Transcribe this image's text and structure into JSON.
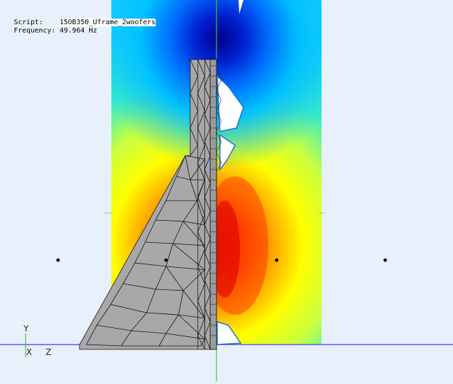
{
  "info": {
    "script_label": "Script:",
    "script_value": "15OB350_Uframe_2woofers",
    "frequency_label": "Frequency:",
    "frequency_value": "49.964 Hz"
  },
  "axes": {
    "y": "Y",
    "x": "X",
    "z": "Z"
  },
  "colors": {
    "background": "#e8f1fb",
    "mesh_fill": "#a8a8a8",
    "mesh_edge": "#111111",
    "horizontal_axis": "#3b3bff",
    "vertical_axis": "#38c838"
  },
  "field_colormap": [
    "#00008b",
    "#0050ff",
    "#00c8ff",
    "#40f0c0",
    "#c8ff40",
    "#ffff00",
    "#ffa000",
    "#ff3000",
    "#d00000"
  ]
}
